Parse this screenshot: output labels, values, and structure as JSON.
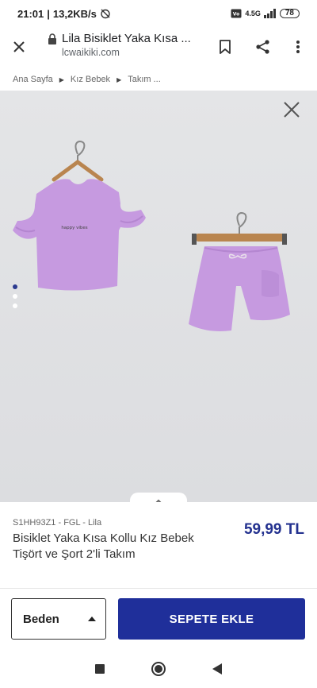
{
  "status": {
    "time": "21:01",
    "speed": "13,2KB/s",
    "network": "4.5G",
    "battery": "78"
  },
  "browser": {
    "title": "Lila Bisiklet Yaka Kısa ...",
    "domain": "lcwaikiki.com"
  },
  "breadcrumb": [
    "Ana Sayfa",
    "Kız Bebek",
    "Takım ..."
  ],
  "gallery": {
    "slides": 3,
    "active_slide": 0,
    "tshirt_print": "happy vibes"
  },
  "product": {
    "sku": "S1HH93Z1 - FGL - Lila",
    "name": "Bisiklet Yaka Kısa Kollu Kız Bebek Tişört ve Şort 2'li Takım",
    "price": "59,99 TL"
  },
  "actions": {
    "size_label": "Beden",
    "add_to_cart": "SEPETE EKLE"
  },
  "colors": {
    "brand_blue": "#1f2f9a",
    "price_blue": "#23318f",
    "garment_lilac": "#c69ae0"
  }
}
